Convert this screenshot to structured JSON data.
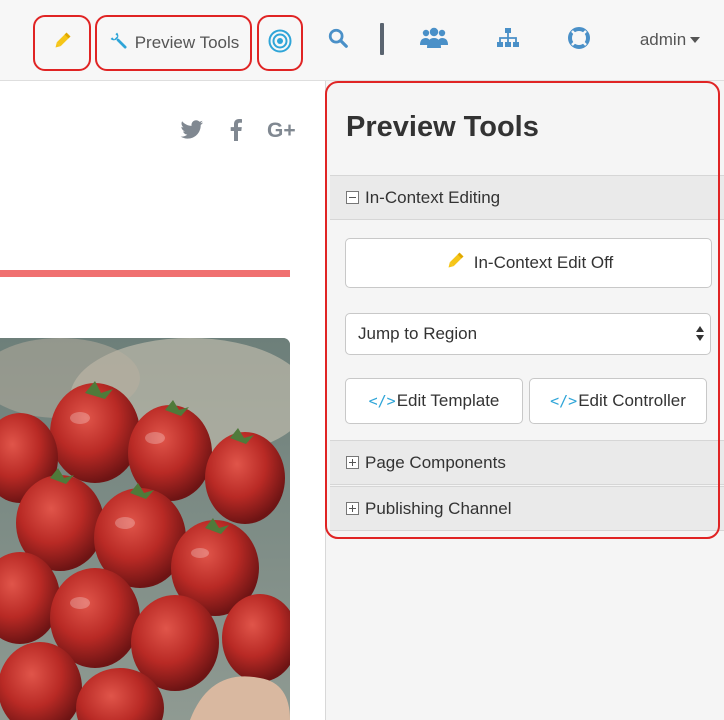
{
  "toolbar": {
    "preview_tools_label": "Preview Tools",
    "user_label": "admin",
    "icons": [
      "pencil-icon",
      "wrench-icon",
      "target-icon",
      "search-icon",
      "users-icon",
      "sitemap-icon",
      "lifebuoy-icon"
    ],
    "colors": {
      "pencil": "#f5c518",
      "wrench": "#2fa5d8",
      "target": "#2fa5d8",
      "nav_icons": "#4a90c8",
      "highlight": "#e02424"
    }
  },
  "site": {
    "social_icons": [
      "twitter-icon",
      "facebook-icon",
      "google-plus-icon"
    ],
    "accent_color": "#f07070"
  },
  "panel": {
    "title": "Preview Tools",
    "sections": {
      "in_context_editing": "In-Context Editing",
      "page_components": "Page Components",
      "publishing_channel": "Publishing Channel"
    },
    "edit_toggle_label": "In-Context Edit Off",
    "region_select": {
      "selected": "Jump to Region"
    },
    "edit_template_label": "Edit Template",
    "edit_controller_label": "Edit Controller",
    "code_glyph": "</>"
  }
}
